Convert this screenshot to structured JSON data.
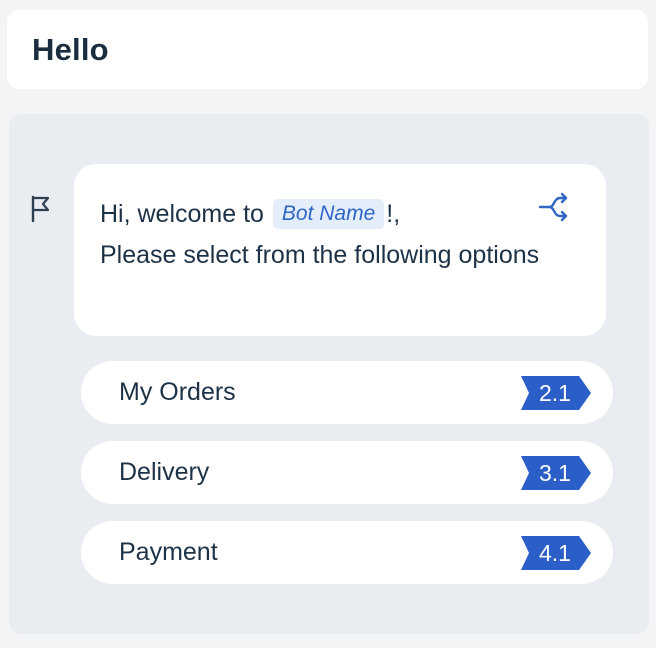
{
  "header": {
    "title": "Hello"
  },
  "message": {
    "greeting": "Hi, welcome to",
    "bot_name": "Bot Name",
    "after_name": "!,",
    "line2": "Please select from the following options"
  },
  "options": [
    {
      "label": "My Orders",
      "badge": "2.1"
    },
    {
      "label": "Delivery",
      "badge": "3.1"
    },
    {
      "label": "Payment",
      "badge": "4.1"
    }
  ],
  "colors": {
    "badge": "#2b5fc7",
    "accent": "#2f66c4",
    "panel": "#e9ecf0"
  },
  "icons": {
    "flag": "flag-icon",
    "branch": "branch-icon"
  }
}
